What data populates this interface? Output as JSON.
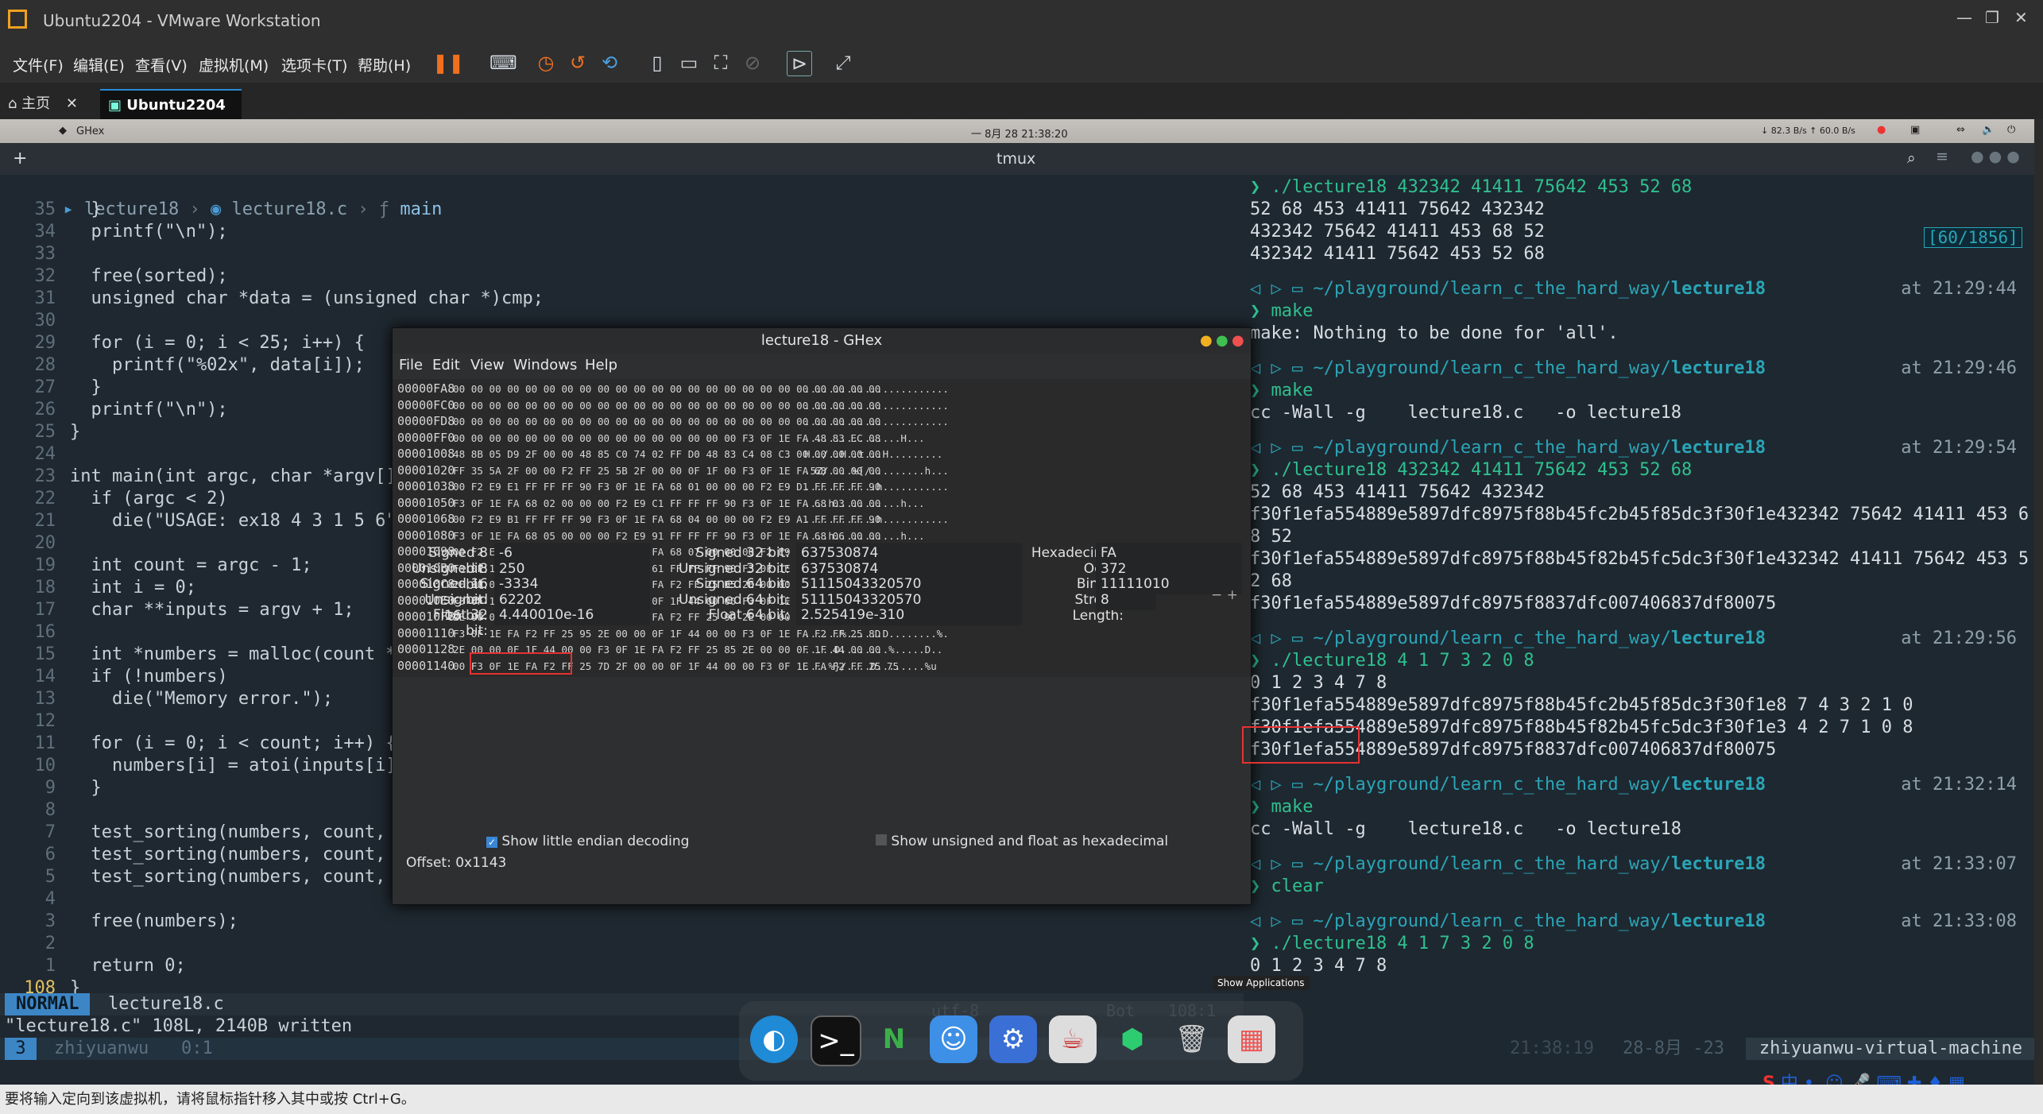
{
  "vmware": {
    "title": "Ubuntu2204 - VMware Workstation",
    "menu": [
      "文件(F)",
      "编辑(E)",
      "查看(V)",
      "虚拟机(M)",
      "选项卡(T)",
      "帮助(H)"
    ],
    "tabs": [
      "主页",
      "Ubuntu2204"
    ],
    "status": "要将输入定向到该虚拟机，请将鼠标指针移入其中或按 Ctrl+G。"
  },
  "topbar": {
    "app": "GHex",
    "datetime": "一 8月 28  21:38:20",
    "netspeed": "↓ 82.3 B/s  ↑ 60.0 B/s"
  },
  "tmux": {
    "title": "tmux"
  },
  "editor": {
    "breadcrumb": [
      "lecture18",
      "lecture18.c",
      "main"
    ],
    "lines": [
      {
        "n": "35",
        "t": "  }"
      },
      {
        "n": "34",
        "t": "  printf(\"\\n\");"
      },
      {
        "n": "33",
        "t": ""
      },
      {
        "n": "32",
        "t": "  free(sorted);"
      },
      {
        "n": "31",
        "t": "  unsigned char *data = (unsigned char *)cmp;"
      },
      {
        "n": "30",
        "t": ""
      },
      {
        "n": "29",
        "t": "  for (i = 0; i < 25; i++) {"
      },
      {
        "n": "28",
        "t": "    printf(\"%02x\", data[i]);"
      },
      {
        "n": "27",
        "t": "  }"
      },
      {
        "n": "26",
        "t": "  printf(\"\\n\");"
      },
      {
        "n": "25",
        "t": "}"
      },
      {
        "n": "24",
        "t": ""
      },
      {
        "n": "23",
        "t": "int main(int argc, char *argv[])"
      },
      {
        "n": "22",
        "t": "  if (argc < 2)"
      },
      {
        "n": "21",
        "t": "    die(\"USAGE: ex18 4 3 1 5 6\")"
      },
      {
        "n": "20",
        "t": ""
      },
      {
        "n": "19",
        "t": "  int count = argc - 1;"
      },
      {
        "n": "18",
        "t": "  int i = 0;"
      },
      {
        "n": "17",
        "t": "  char **inputs = argv + 1;"
      },
      {
        "n": "16",
        "t": ""
      },
      {
        "n": "15",
        "t": "  int *numbers = malloc(count *"
      },
      {
        "n": "14",
        "t": "  if (!numbers)"
      },
      {
        "n": "13",
        "t": "    die(\"Memory error.\");"
      },
      {
        "n": "12",
        "t": ""
      },
      {
        "n": "11",
        "t": "  for (i = 0; i < count; i++) {"
      },
      {
        "n": "10",
        "t": "    numbers[i] = atoi(inputs[i])"
      },
      {
        "n": "9",
        "t": "  }"
      },
      {
        "n": "8",
        "t": ""
      },
      {
        "n": "7",
        "t": "  test_sorting(numbers, count, s"
      },
      {
        "n": "6",
        "t": "  test_sorting(numbers, count, r"
      },
      {
        "n": "5",
        "t": "  test_sorting(numbers, count, strange_order);"
      },
      {
        "n": "4",
        "t": ""
      },
      {
        "n": "3",
        "t": "  free(numbers);"
      },
      {
        "n": "2",
        "t": ""
      },
      {
        "n": "1",
        "t": "  return 0;"
      },
      {
        "n": "108",
        "t": "}"
      }
    ],
    "mode": "NORMAL",
    "filename": "lecture18.c",
    "message": "\"lecture18.c\" 108L, 2140B written",
    "tmux_index": "3",
    "tmux_user": "zhiyuanwu",
    "tmux_window": "0:1",
    "encoding": "utf-8",
    "position": "Bot",
    "position_line": "108:1"
  },
  "terminal": {
    "scroll_indicator": "[60/1856]",
    "path_prefix": "~/playground/learn_c_the_hard_way/",
    "path_dir": "lecture18",
    "blocks": [
      {
        "lines": [
          "❯ ./lecture18 432342 41411 75642 453 52 68",
          "52 68 453 41411 75642 432342",
          "432342 75642 41411 453 68 52",
          "432342 41411 75642 453 52 68"
        ]
      },
      {
        "prompt_time": "at 21:29:44",
        "lines": [
          "❯ make",
          "make: Nothing to be done for 'all'."
        ]
      },
      {
        "prompt_time": "at 21:29:46",
        "lines": [
          "❯ make",
          "cc -Wall -g    lecture18.c   -o lecture18"
        ]
      },
      {
        "prompt_time": "at 21:29:54",
        "lines": [
          "❯ ./lecture18 432342 41411 75642 453 52 68",
          "52 68 453 41411 75642 432342",
          "f30f1efa554889e5897dfc8975f88b45fc2b45f85dc3f30f1e432342 75642 41411 453 6",
          "8 52",
          "f30f1efa554889e5897dfc8975f88b45f82b45fc5dc3f30f1e432342 41411 75642 453 5",
          "2 68",
          "f30f1efa554889e5897dfc8975f8837dfc007406837df80075"
        ]
      },
      {
        "prompt_time": "at 21:29:56",
        "lines": [
          "❯ ./lecture18 4 1 7 3 2 0 8",
          "0 1 2 3 4 7 8",
          "f30f1efa554889e5897dfc8975f88b45fc2b45f85dc3f30f1e8 7 4 3 2 1 0",
          "f30f1efa554889e5897dfc8975f88b45f82b45fc5dc3f30f1e3 4 2 7 1 0 8",
          "f30f1efa554889e5897dfc8975f8837dfc007406837df80075"
        ]
      },
      {
        "prompt_time": "at 21:32:14",
        "lines": [
          "❯ make",
          "cc -Wall -g    lecture18.c   -o lecture18"
        ]
      },
      {
        "prompt_time": "at 21:33:07",
        "lines": [
          "❯ clear"
        ]
      },
      {
        "prompt_time": "at 21:33:08",
        "lines": [
          "❯ ./lecture18 4 1 7 3 2 0 8",
          "0 1 2 3 4 7 8"
        ]
      }
    ],
    "status_time": "21:38:19",
    "status_date": "28-8月 -23",
    "status_host": "zhiyuanwu-virtual-machine"
  },
  "ghex": {
    "title": "lecture18 - GHex",
    "menu": [
      "File",
      "Edit",
      "View",
      "Windows",
      "Help"
    ],
    "rows": [
      {
        "addr": "00000FA8",
        "hex": "00 00 00 00 00 00 00 00 00 00 00 00 00 00 00 00 00 00 00 00 00 00 00 00",
        "ascii": "........................"
      },
      {
        "addr": "00000FC0",
        "hex": "00 00 00 00 00 00 00 00 00 00 00 00 00 00 00 00 00 00 00 00 00 00 00 00",
        "ascii": "........................"
      },
      {
        "addr": "00000FD8",
        "hex": "00 00 00 00 00 00 00 00 00 00 00 00 00 00 00 00 00 00 00 00 00 00 00 00",
        "ascii": "........................"
      },
      {
        "addr": "00000FF0",
        "hex": "00 00 00 00 00 00 00 00 00 00 00 00 00 00 00 00 F3 0F 1E FA 48 83 EC 08",
        "ascii": "................H..."
      },
      {
        "addr": "00001008",
        "hex": "48 8B 05 D9 2F 00 00 48 85 C0 74 02 FF D0 48 83 C4 08 C3 00 00 00 00 00",
        "ascii": "H../..H..t...H........."
      },
      {
        "addr": "00001020",
        "hex": "FF 35 5A 2F 00 00 F2 FF 25 5B 2F 00 00 0F 1F 00 F3 0F 1E FA 68 00 00 00",
        "ascii": ".5Z/....%[/.........h..."
      },
      {
        "addr": "00001038",
        "hex": "00 F2 E9 E1 FF FF FF 90 F3 0F 1E FA 68 01 00 00 00 F2 E9 D1 FF FF FF 90",
        "ascii": "............h..........."
      },
      {
        "addr": "00001050",
        "hex": "F3 0F 1E FA 68 02 00 00 00 F2 E9 C1 FF FF FF 90 F3 0F 1E FA 68 03 00 00",
        "ascii": "....h...........h..."
      },
      {
        "addr": "00001068",
        "hex": "00 F2 E9 B1 FF FF FF 90 F3 0F 1E FA 68 04 00 00 00 F2 E9 A1 FF FF FF 90",
        "ascii": "............h..........."
      },
      {
        "addr": "00001080",
        "hex": "F3 0F 1E FA 68 05 00 00 00 F2 E9 91 FF FF FF 90 F3 0F 1E FA 68 06 00 00",
        "ascii": "....h...........h..."
      },
      {
        "addr": "00001098",
        "hex": "00 F2 E9 81 FF FF FF 90 F3 0F 1E FA 68 07 00 00 00 F2 E9 71 FF FF FF 90",
        "ascii": "............h......q...."
      },
      {
        "addr": "000010B0",
        "hex": "F3 0F 1E FA 68 08 00 00 00 F2 E9 61 FF FF FF 90 F3 0F 1E FA F2 FF 25 2D",
        "ascii": "....h......a........%-"
      },
      {
        "addr": "000010C8",
        "hex": "2F 00 00 0F 1F 44 00 00 F3 0F 1E FA F2 FF 25 B5 2E 00 00 0F 1F 44 00 00",
        "ascii": "/....D........%.....D.."
      },
      {
        "addr": "000010E0",
        "hex": "F3 0F 1E FA F2 FF 25 AD 2E 00 00 0F 1F 44 00 00 F3 0F 1E FA F2 FF 25 A5",
        "ascii": "......%......D........%."
      },
      {
        "addr": "000010F8",
        "hex": "2E 00 00 0F 1F 44 00 00 F3 0F 1E FA F2 FF 25 9D 2E 00 00 0F 1F 44 00 00",
        "ascii": ".....D........%.....D.."
      },
      {
        "addr": "00001110",
        "hex": "F3 0F 1E FA F2 FF 25 95 2E 00 00 0F 1F 44 00 00 F3 0F 1E FA F2 FF 25 8D",
        "ascii": "......%......D........%."
      },
      {
        "addr": "00001128",
        "hex": "2E 00 00 0F 1F 44 00 00 F3 0F 1E FA F2 FF 25 85 2E 00 00 0F 1F 44 00 00",
        "ascii": ".....D........%.....D.."
      },
      {
        "addr": "00001140",
        "hex": "00 F3 0F 1E FA F2 FF 25 7D 2F 00 00 0F 1F 44 00 00 F3 0F 1E FA F2 FF 25 75",
        "ascii": "....%}/....D........%u"
      }
    ],
    "stats": [
      {
        "label": "Signed 8 bit:",
        "value": "-6"
      },
      {
        "label": "Unsigned 8 bit:",
        "value": "250"
      },
      {
        "label": "Signed 16 bit:",
        "value": "-3334"
      },
      {
        "label": "Unsigned 16 bit:",
        "value": "62202"
      },
      {
        "label": "Float 32 bit:",
        "value": "4.440010e-16"
      },
      {
        "label": "Signed 32 bit:",
        "value": "637530874"
      },
      {
        "label": "Unsigned 32 bit:",
        "value": "637530874"
      },
      {
        "label": "Signed 64 bit:",
        "value": "51115043320570"
      },
      {
        "label": "Unsigned 64 bit:",
        "value": "51115043320570"
      },
      {
        "label": "Float 64 bit:",
        "value": "2.525419e-310"
      },
      {
        "label": "Hexadecimal:",
        "value": "FA"
      },
      {
        "label": "Octal:",
        "value": "372"
      },
      {
        "label": "Binary:",
        "value": "11111010"
      },
      {
        "label": "Stream Length:",
        "value": "8"
      }
    ],
    "little_endian_label": "Show little endian decoding",
    "unsigned_hex_label": "Show unsigned and float as hexadecimal",
    "offset": "Offset: 0x1143"
  },
  "dock": {
    "tooltip": "Show Applications",
    "apps": [
      "edge-icon",
      "terminal-icon",
      "nvim-icon",
      "finder-icon",
      "settings-icon",
      "java-icon",
      "ghex-icon",
      "trash-icon",
      "apps-grid-icon"
    ]
  },
  "colors": {
    "accent": "#2aa5b7",
    "prompt": "#2fc08f",
    "highlight": "#e53232"
  }
}
